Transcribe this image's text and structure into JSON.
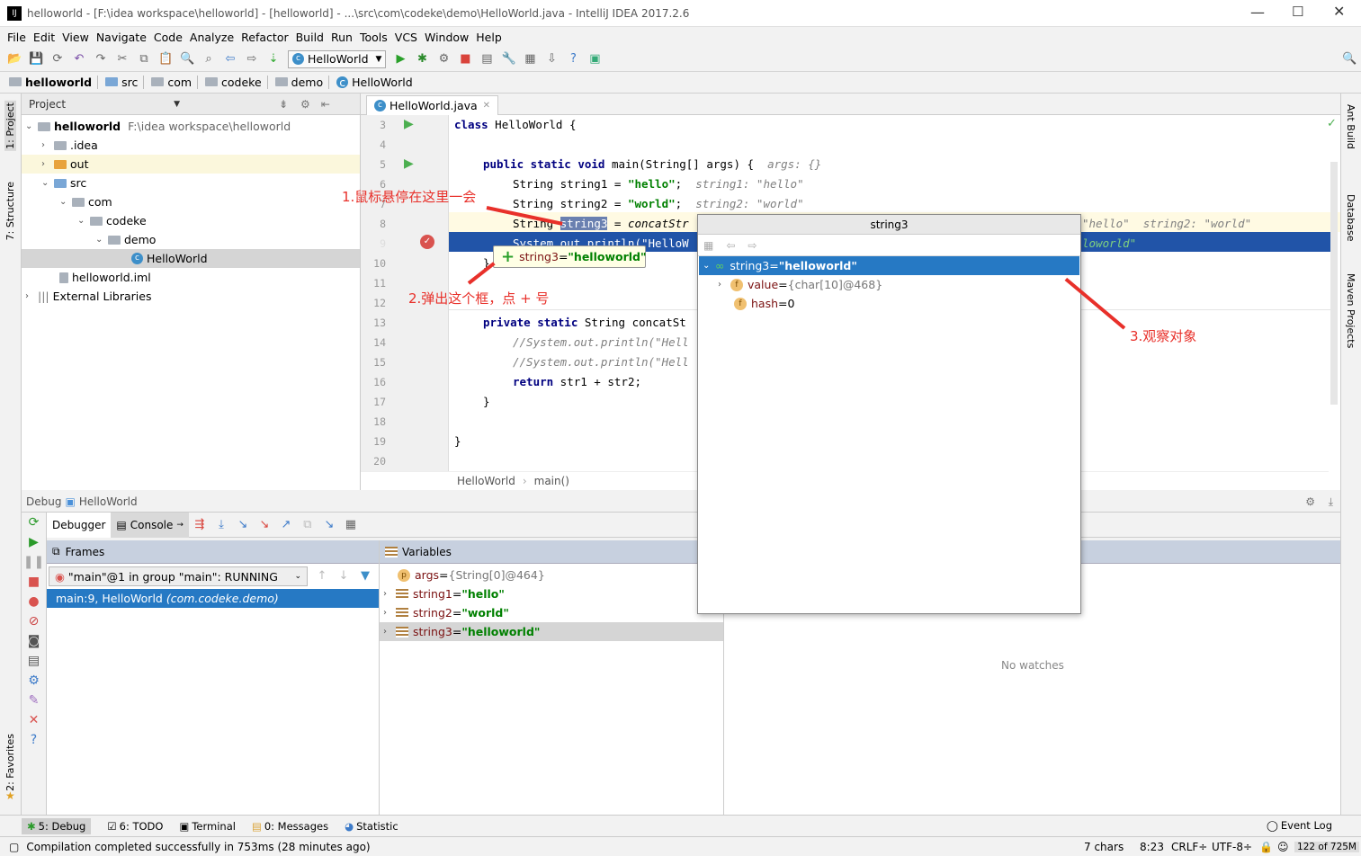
{
  "window": {
    "title": "helloworld - [F:\\idea workspace\\helloworld] - [helloworld] - ...\\src\\com\\codeke\\demo\\HelloWorld.java - IntelliJ IDEA 2017.2.6",
    "controls": [
      "minimize",
      "maximize",
      "close"
    ]
  },
  "menu": [
    "File",
    "Edit",
    "View",
    "Navigate",
    "Code",
    "Analyze",
    "Refactor",
    "Build",
    "Run",
    "Tools",
    "VCS",
    "Window",
    "Help"
  ],
  "toolbar": {
    "run_config": "HelloWorld"
  },
  "navbar": [
    "helloworld",
    "src",
    "com",
    "codeke",
    "demo",
    "HelloWorld"
  ],
  "left_stripe": {
    "project": "1: Project",
    "structure": "7: Structure",
    "favorites": "2: Favorites"
  },
  "right_stripe": {
    "ant": "Ant Build",
    "database": "Database",
    "maven": "Maven Projects"
  },
  "project": {
    "title": "Project",
    "root": "helloworld",
    "root_path": "F:\\idea workspace\\helloworld",
    "items": [
      {
        "label": ".idea"
      },
      {
        "label": "out"
      },
      {
        "label": "src"
      },
      {
        "label": "com"
      },
      {
        "label": "codeke"
      },
      {
        "label": "demo"
      },
      {
        "label": "HelloWorld"
      },
      {
        "label": "helloworld.iml"
      },
      {
        "label": "External Libraries"
      }
    ]
  },
  "editor": {
    "tab": "HelloWorld.java",
    "lines": [
      "3",
      "4",
      "5",
      "6",
      "7",
      "8",
      "9",
      "10",
      "11",
      "12",
      "13",
      "14",
      "15",
      "16",
      "17",
      "18",
      "19",
      "20"
    ],
    "code": {
      "l3a": "class",
      " l3b": " HelloWorld {",
      "l5a": "public static void",
      " l5b": " main(String[] args) {  ",
      "l5h": "args: {}",
      "l6a": "String string1 = ",
      "l6s": "\"hello\"",
      "l6c": ";  ",
      "l6h": "string1: \"hello\"",
      "l7a": "String string2 = ",
      "l7s": "\"world\"",
      "l7c": ";  ",
      "l7h": "string2: \"world\"",
      "l8a": "String ",
      "l8v": "string3",
      "l8b": " = ",
      "l8c": "concatStr",
      "l8h": "\"hello\"  string2: \"world\"",
      "l9a": "System.out.println(\"HelloW",
      "l9h": "loworld\"",
      "l10": "}",
      "l13a": "private static",
      " l13b": " String concatSt",
      "l14": "//System.out.println(\"Hell",
      "l15": "//System.out.println(\"Hell",
      "l16a": "return",
      " l16b": " str1 + str2;",
      "l17": "}",
      "l19": "}"
    },
    "breadcrumb": [
      "HelloWorld",
      "main()"
    ]
  },
  "tooltip": {
    "name": "string3",
    "eq": " = ",
    "value": "\"helloworld\""
  },
  "popup": {
    "title": "string3",
    "root": {
      "name": "string3",
      "eq": " = ",
      "value": "\"helloworld\""
    },
    "children": [
      {
        "name": "value",
        "eq": " = ",
        "value": "{char[10]@468}"
      },
      {
        "name": "hash",
        "eq": " = ",
        "value": "0"
      }
    ]
  },
  "annotations": {
    "a1": "1.鼠标悬停在这里一会",
    "a2": "2.弹出这个框，点 + 号",
    "a3": "3.观察对象"
  },
  "debug": {
    "label": "Debug",
    "config": "HelloWorld",
    "tabs": [
      "Debugger",
      "Console"
    ],
    "frames_title": "Frames",
    "thread": "\"main\"@1 in group \"main\": RUNNING",
    "frame": "main:9, HelloWorld",
    "frame_pkg": "(com.codeke.demo)",
    "variables_title": "Variables",
    "variables": [
      {
        "name": "args",
        "eq": " = ",
        "value": "{String[0]@464}"
      },
      {
        "name": "string1",
        "eq": " = ",
        "value": "\"hello\""
      },
      {
        "name": "string2",
        "eq": " = ",
        "value": "\"world\""
      },
      {
        "name": "string3",
        "eq": " = ",
        "value": "\"helloworld\""
      }
    ],
    "watches_empty": "No watches"
  },
  "bottom_tabs": [
    "5: Debug",
    "6: TODO",
    "Terminal",
    "0: Messages",
    "Statistic",
    "Event Log"
  ],
  "status": {
    "message": "Compilation completed successfully in 753ms (28 minutes ago)",
    "chars": "7 chars",
    "pos": "8:23",
    "line_sep": "CRLF÷",
    "encoding": "UTF-8÷",
    "memory": "122 of 725M"
  },
  "colors": {
    "selection": "#2154a8",
    "accent_red": "#e8302a",
    "string": "#008000",
    "keyword": "#000080"
  }
}
